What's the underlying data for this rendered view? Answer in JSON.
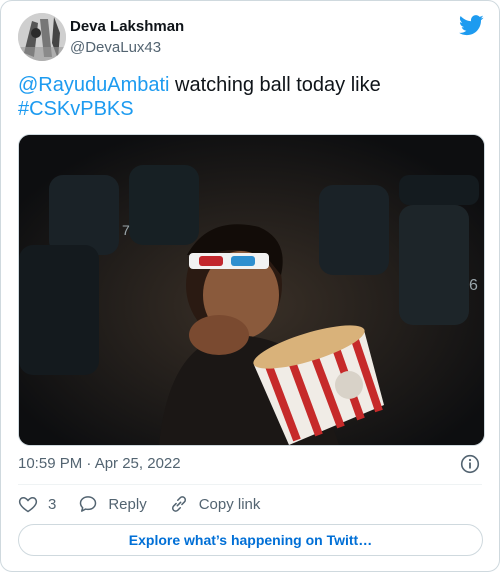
{
  "author": {
    "name": "Deva Lakshman",
    "handle": "@DevaLux43"
  },
  "tweet": {
    "mention": "@RayuduAmbati",
    "text": " watching ball today like",
    "hashtag": "#CSKvPBKS"
  },
  "meta": {
    "timestamp": "10:59 PM · Apr 25, 2022"
  },
  "actions": {
    "like_count": "3",
    "reply_label": "Reply",
    "copy_link_label": "Copy link"
  },
  "explore_label": "Explore what’s happening on Twitt…",
  "colors": {
    "link": "#1d9bf0",
    "text": "#0f1419",
    "secondary": "#536471",
    "border": "#cfd9de"
  },
  "icons": {
    "brand": "twitter-bird-icon",
    "info": "info-icon",
    "like": "heart-icon",
    "reply": "reply-bubble-icon",
    "copy": "link-icon"
  }
}
